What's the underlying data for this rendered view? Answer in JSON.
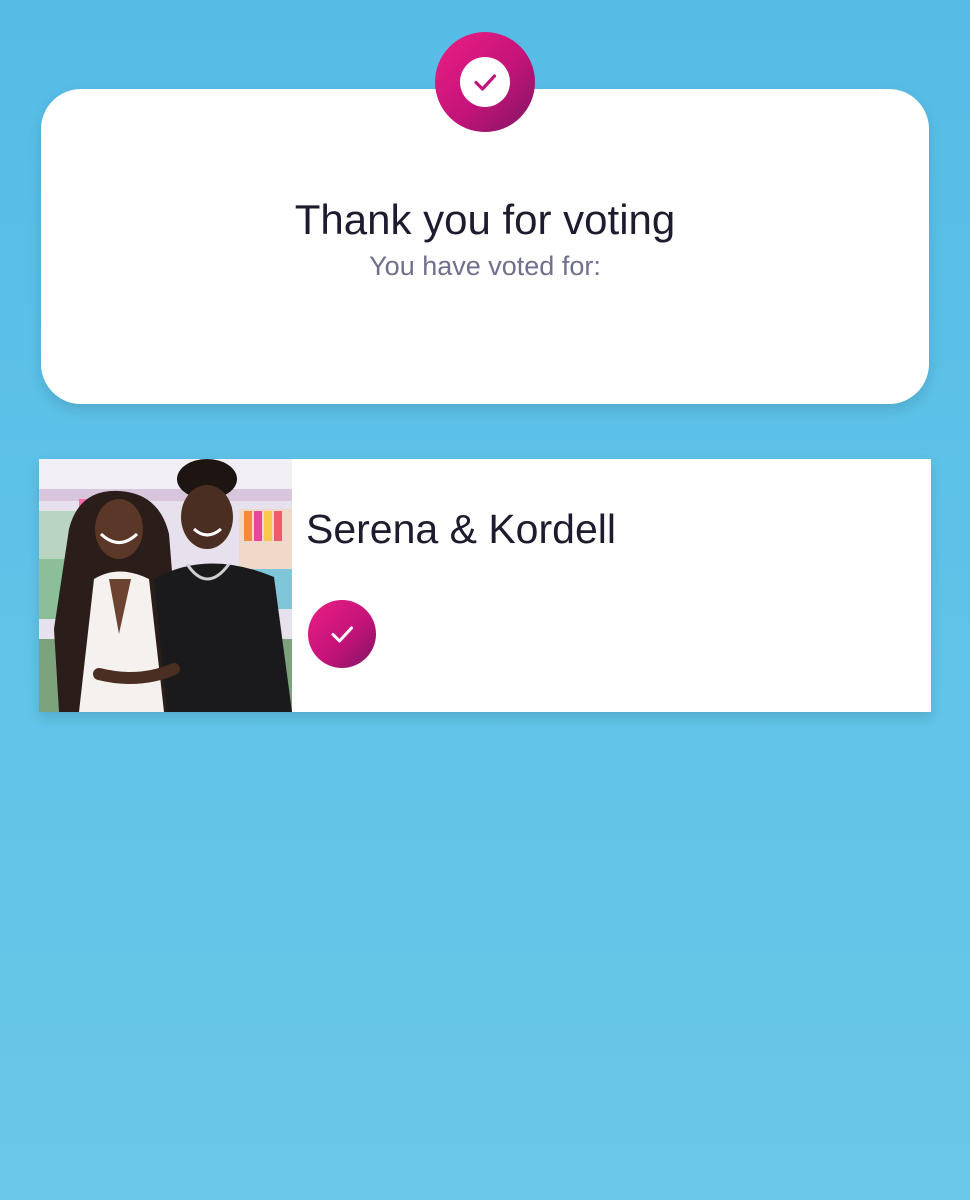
{
  "confirmation": {
    "title": "Thank you for voting",
    "subtitle": "You have voted for:",
    "badge_icon": "check-circle-icon"
  },
  "vote": {
    "name": "Serena & Kordell",
    "photo": "couple-photo",
    "status_icon": "check-icon"
  },
  "colors": {
    "background": "#5ec1e8",
    "accent_start": "#ec1f83",
    "accent_end": "#7f1663",
    "text_primary": "#1c1c2e",
    "text_secondary": "#6f6f8e"
  }
}
